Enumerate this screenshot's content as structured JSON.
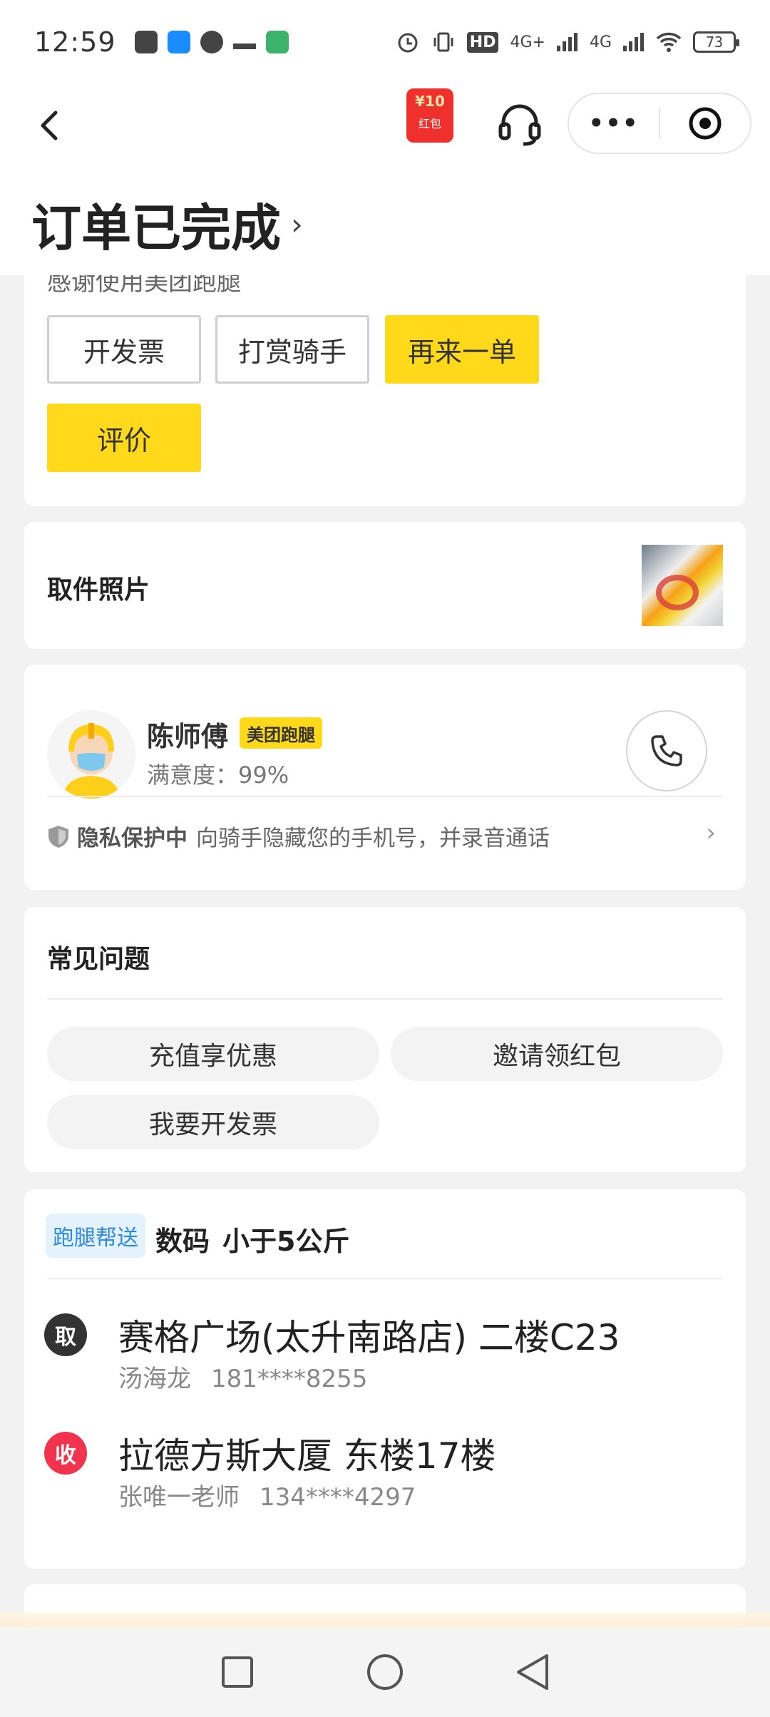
{
  "status_bar": {
    "time": "12:59",
    "network_1": "4G+",
    "network_2": "4G",
    "hd": "HD",
    "battery": "73"
  },
  "header": {
    "red_packet_amount": "¥10",
    "red_packet_label": "红包",
    "title": "订单已完成",
    "title_chevron": "›",
    "more_label": "•••"
  },
  "actions": {
    "thanks_text": "感谢使用美团跑腿",
    "invoice_button": "开发票",
    "tip_button": "打赏骑手",
    "reorder_button": "再来一单",
    "rate_button": "评价"
  },
  "pickup_photo": {
    "title": "取件照片"
  },
  "rider": {
    "name": "陈师傅",
    "badge": "美团跑腿",
    "satisfaction": "满意度：99%",
    "privacy_title": "隐私保护中",
    "privacy_desc": "向骑手隐藏您的手机号，并录音通话",
    "privacy_chevron": "›"
  },
  "faq": {
    "title": "常见问题",
    "items": [
      "充值享优惠",
      "邀请领红包",
      "我要开发票"
    ]
  },
  "order": {
    "service_tag": "跑腿帮送",
    "category": "数码",
    "weight": "小于5公斤",
    "pickup": {
      "marker": "取",
      "address": "赛格广场(太升南路店) 二楼C23",
      "contact_name": "汤海龙",
      "contact_phone": "181****8255"
    },
    "dropoff": {
      "marker": "收",
      "address": "拉德方斯大厦 东楼17楼",
      "contact_name": "张唯一老师",
      "contact_phone": "134****4297"
    }
  },
  "icons": {
    "back": "chevron-left-icon",
    "support": "headset-icon",
    "miniapp_close": "target-icon",
    "phone": "phone-icon",
    "shield": "shield-icon"
  },
  "colors": {
    "accent_yellow": "#FFD91A",
    "pickup_dot": "#333333",
    "dropoff_dot": "#F2334D",
    "service_tag_blue": "#2D8AE0"
  }
}
